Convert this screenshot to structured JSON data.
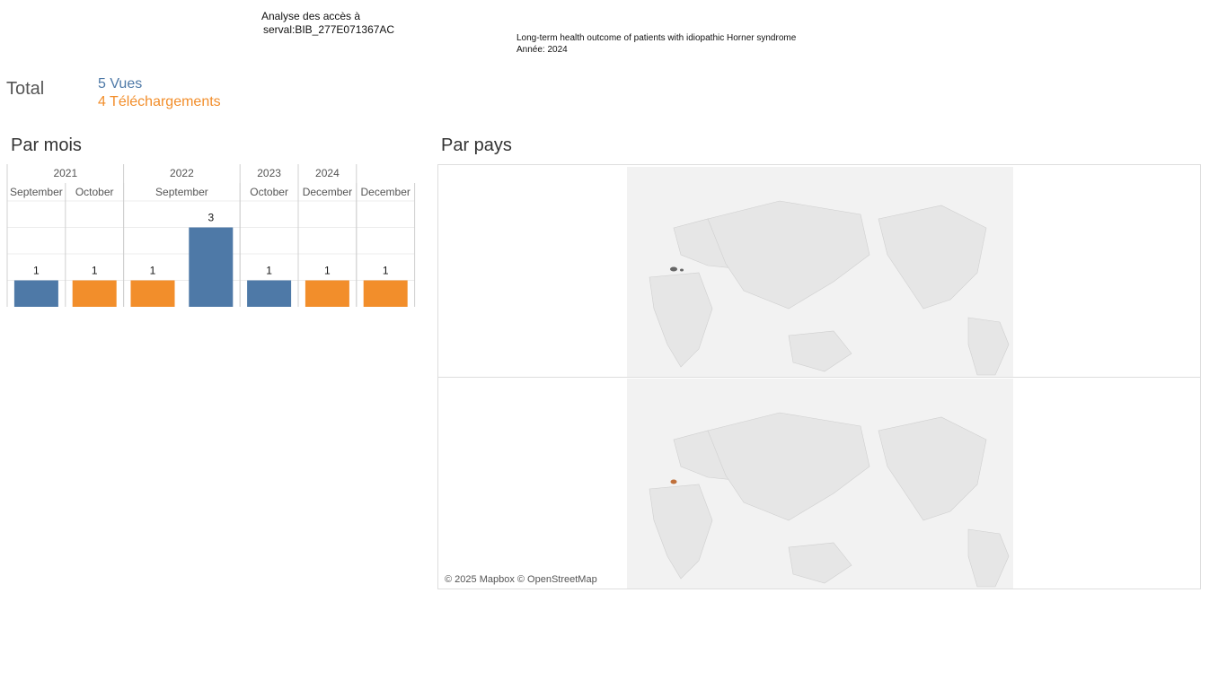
{
  "header": {
    "line1": "Analyse des accès à",
    "line2": "serval:BIB_277E071367AC"
  },
  "document": {
    "title": "Long-term health outcome of patients with idiopathic Horner syndrome",
    "year_label": "Année: 2024"
  },
  "totals": {
    "label": "Total",
    "views": "5 Vues",
    "downloads": "4 Téléchargements"
  },
  "sections": {
    "by_month": "Par mois",
    "by_country": "Par pays"
  },
  "map": {
    "credit": "© 2025 Mapbox © OpenStreetMap"
  },
  "colors": {
    "views": "#4e79a7",
    "downloads": "#f28e2b"
  },
  "chart_data": {
    "type": "bar",
    "year_groups": [
      {
        "year": "2021",
        "span": 2
      },
      {
        "year": "2022",
        "span": 2
      },
      {
        "year": "2023",
        "span": 1
      },
      {
        "year": "2024",
        "span": 1
      }
    ],
    "month_groups": [
      {
        "month": "September",
        "span": 1
      },
      {
        "month": "October",
        "span": 1
      },
      {
        "month": "September",
        "span": 2
      },
      {
        "month": "October",
        "span": 1
      },
      {
        "month": "December",
        "span": 1
      },
      {
        "month": "December",
        "span": 1
      }
    ],
    "bars": [
      {
        "value": 1,
        "series": "views"
      },
      {
        "value": 1,
        "series": "downloads"
      },
      {
        "value": 1,
        "series": "downloads"
      },
      {
        "value": 3,
        "series": "views"
      },
      {
        "value": 1,
        "series": "views"
      },
      {
        "value": 1,
        "series": "downloads"
      },
      {
        "value": 1,
        "series": "downloads"
      }
    ],
    "ylim": [
      0,
      4
    ],
    "grid": true
  }
}
